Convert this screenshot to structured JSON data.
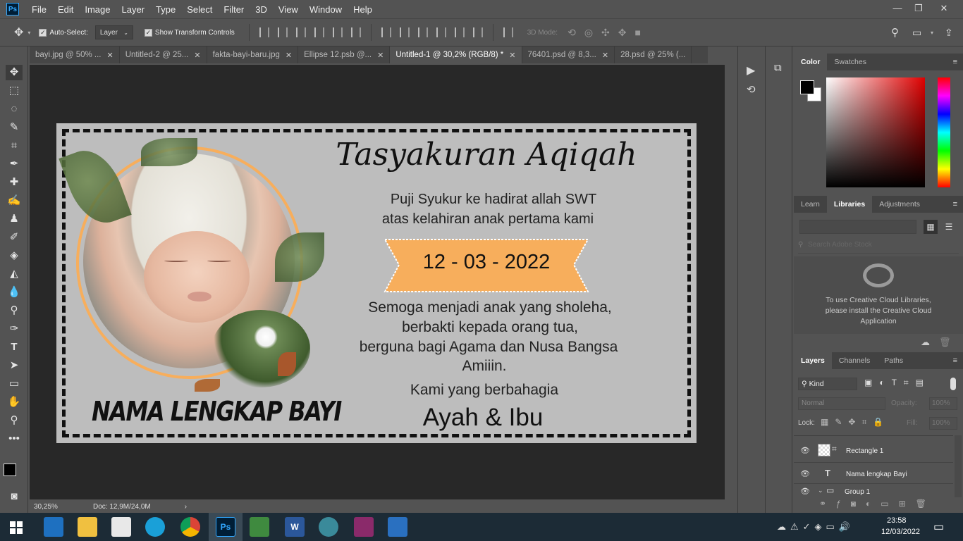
{
  "menubar": {
    "app_icon": "Ps",
    "items": [
      "File",
      "Edit",
      "Image",
      "Layer",
      "Type",
      "Select",
      "Filter",
      "3D",
      "View",
      "Window",
      "Help"
    ],
    "controls": [
      "—",
      "❐",
      "✕"
    ]
  },
  "options": {
    "auto_select_label": "Auto-Select:",
    "auto_select_value": "Layer",
    "show_transform_label": "Show Transform Controls",
    "mode_3d_label": "3D Mode:"
  },
  "tabs": [
    {
      "label": "bayi.jpg @ 50% ..."
    },
    {
      "label": "Untitled-2 @ 25..."
    },
    {
      "label": "fakta-bayi-baru.jpg"
    },
    {
      "label": "Ellipse 12.psb @..."
    },
    {
      "label": "Untitled-1 @ 30,2% (RGB/8) *"
    },
    {
      "label": "76401.psd @ 8,3..."
    },
    {
      "label": "28.psd @ 25% (..."
    }
  ],
  "design": {
    "title": "Tasyakuran Aqiqah",
    "line1": "Puji Syukur ke hadirat allah SWT",
    "line2": "atas kelahiran anak pertama kami",
    "date": "12 - 03 - 2022",
    "wish1": "Semoga menjadi anak yang sholeha,",
    "wish2": "berbakti kepada orang tua,",
    "wish3": "berguna bagi Agama dan Nusa Bangsa",
    "wish4": "Amiiin.",
    "closing": "Kami yang berbahagia",
    "parents": "Ayah & Ibu",
    "baby_name": "NAMA LENGKAP BAYI",
    "accent_color": "#f7ae5c"
  },
  "status": {
    "zoom": "30,25%",
    "doc": "Doc: 12,9M/24,0M"
  },
  "color_panel": {
    "tabs": [
      "Color",
      "Swatches"
    ]
  },
  "libraries_panel": {
    "tabs": [
      "Learn",
      "Libraries",
      "Adjustments"
    ],
    "search_placeholder": "Search Adobe Stock",
    "message": "To use Creative Cloud Libraries, please install the Creative Cloud Application"
  },
  "layers_panel": {
    "tabs": [
      "Layers",
      "Channels",
      "Paths"
    ],
    "kind_label": "Kind",
    "blend_mode": "Normal",
    "opacity_label": "Opacity:",
    "opacity_value": "100%",
    "lock_label": "Lock:",
    "fill_label": "Fill:",
    "fill_value": "100%",
    "layers": [
      {
        "name": "Rectangle 1"
      },
      {
        "name": "Nama lengkap Bayi"
      },
      {
        "name": "Group 1"
      }
    ]
  },
  "taskbar": {
    "time": "23:58",
    "date": "12/03/2022"
  }
}
